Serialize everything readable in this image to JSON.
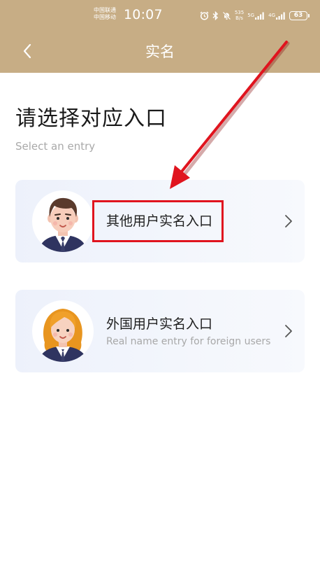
{
  "status_bar": {
    "carrier_1": "中国联通",
    "carrier_2": "中国移动",
    "time": "10:07",
    "net_speed_value": "535",
    "net_speed_unit": "B/s",
    "signal_5g_label": "5G",
    "signal_4g_label": "4G",
    "battery": "63",
    "icons": [
      "alarm-icon",
      "bluetooth-icon",
      "mute-icon",
      "signal-5g-icon",
      "signal-4g-icon",
      "battery-icon"
    ]
  },
  "nav": {
    "title": "实名",
    "back_icon": "chevron-left-icon"
  },
  "header": {
    "title": "请选择对应入口",
    "subtitle": "Select an entry"
  },
  "entries": [
    {
      "title": "其他用户实名入口",
      "subtitle": "",
      "avatar": "male-avatar-icon",
      "chevron": "chevron-right-icon"
    },
    {
      "title": "外国用户实名入口",
      "subtitle": "Real name entry for foreign users",
      "avatar": "female-avatar-icon",
      "chevron": "chevron-right-icon"
    }
  ],
  "colors": {
    "header_bg": "#c7ad85",
    "annotation_red": "#e0141e",
    "card_bg": "#eef2fb"
  }
}
